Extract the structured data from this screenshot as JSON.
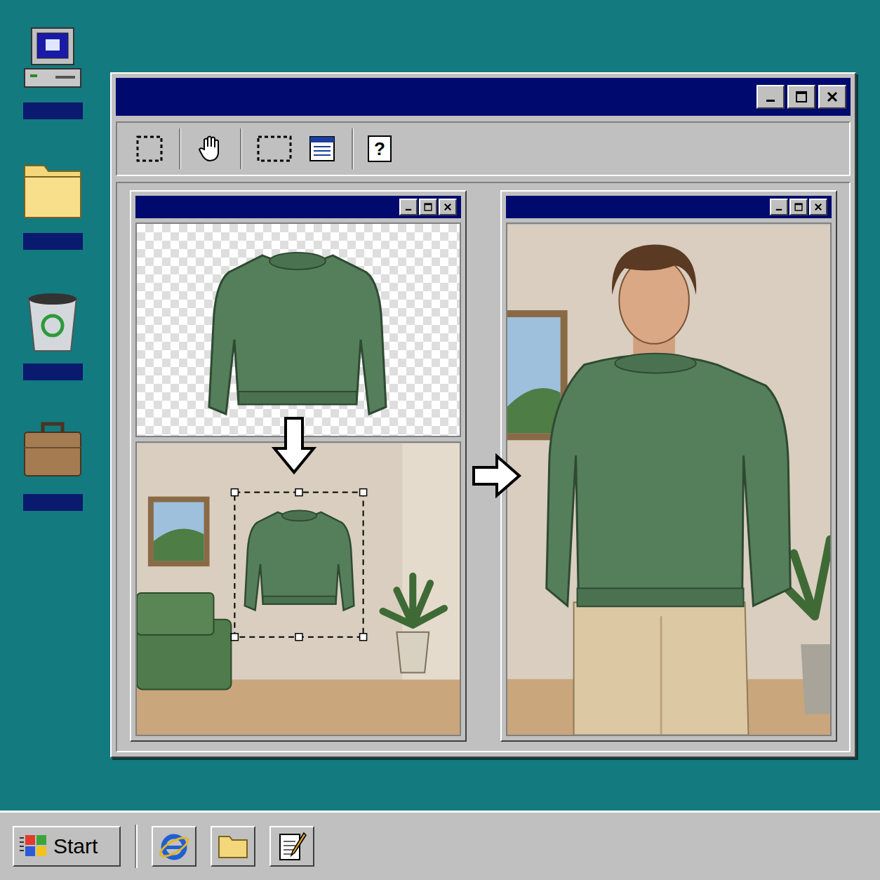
{
  "toolbar": {
    "help": "?"
  },
  "scene": {
    "garment_selected": true
  },
  "taskbar": {
    "start": "Start"
  }
}
